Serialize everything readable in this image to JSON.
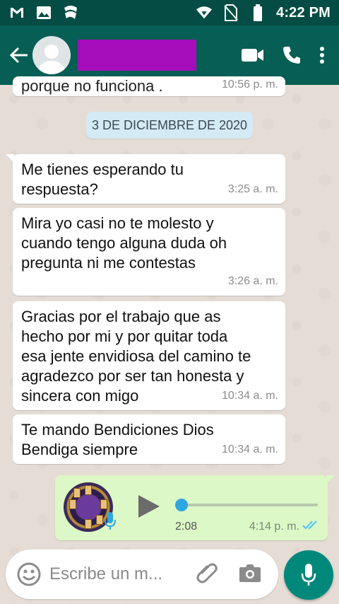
{
  "status_bar": {
    "time": "4:22 PM",
    "left_icons": [
      "gmail-icon",
      "gallery-icon",
      "app-notification-icon"
    ],
    "right_icons": [
      "wifi-icon",
      "no-sim-icon",
      "battery-icon"
    ]
  },
  "header": {
    "back_icon": "arrow-left-icon",
    "actions": [
      "video-call-icon",
      "phone-call-icon",
      "more-vert-icon"
    ],
    "name_redaction_color": "#a50dbb"
  },
  "chat": {
    "partial_message": {
      "text": "porque no funciona .",
      "time": "10:56 p. m."
    },
    "date_chip": "3 DE DICIEMBRE DE 2020",
    "messages": [
      {
        "text": "Me tienes esperando tu\nrespuesta?",
        "time": "3:25 a. m."
      },
      {
        "text": "Mira yo casi no te molesto y\ncuando tengo alguna duda oh\npregunta ni me contestas",
        "time": "3:26 a. m."
      },
      {
        "text": "Gracias por el trabajo que as\nhecho por mi y por quitar toda\nesa jente envidiosa del camino te\nagradezco por ser tan honesta y\nsincera con migo",
        "time": "10:34 a. m."
      },
      {
        "text": "Te mando Bendiciones Dios\nBendiga siempre",
        "time": "10:34 a. m."
      }
    ],
    "voice_note": {
      "duration": "2:08",
      "time": "4:14 p. m.",
      "progress": 0.0,
      "status": "read"
    }
  },
  "composer": {
    "placeholder": "Escribe un m..."
  },
  "colors": {
    "header": "#075e54",
    "status_bar": "#054d44",
    "outgoing_bubble": "#dcf8c6",
    "incoming_bubble": "#ffffff",
    "fab": "#00897b",
    "read_ticks": "#4fc3f7"
  }
}
